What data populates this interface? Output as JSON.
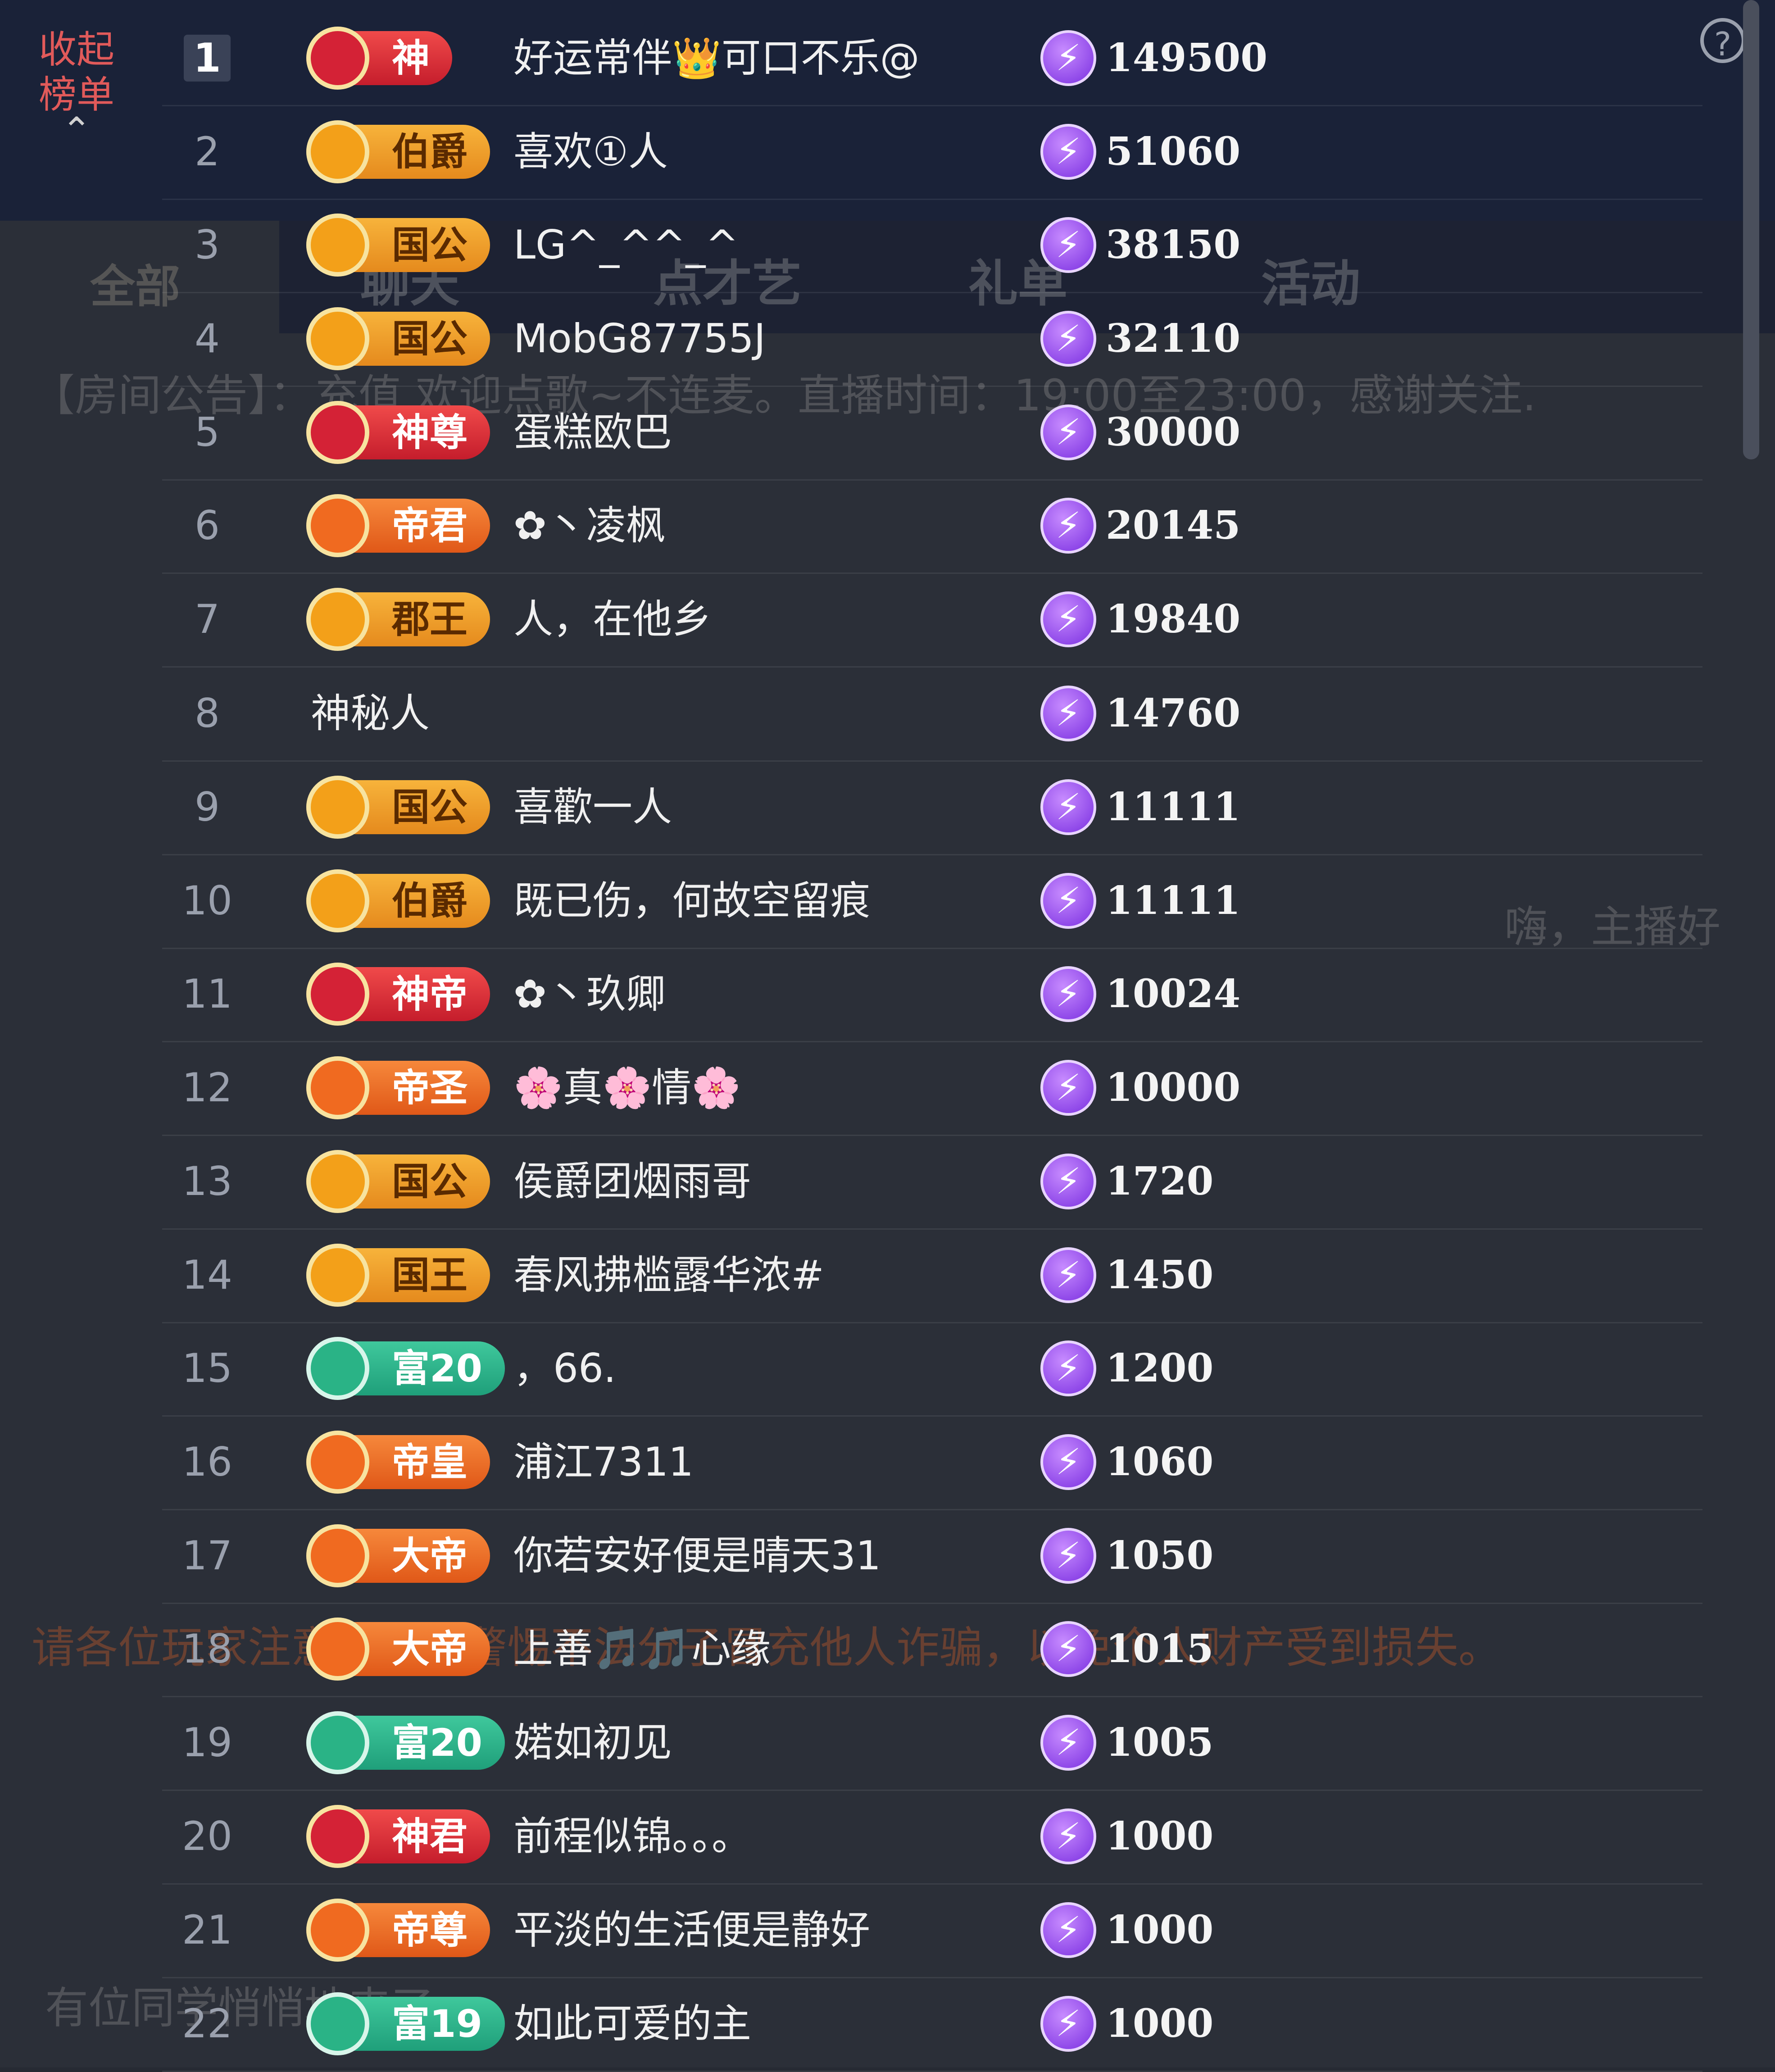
{
  "panel": {
    "collapse_label": "收起榜单",
    "collapse_icon": "chevron-up-icon",
    "help_icon": "question-circle-icon",
    "help_glyph": "?"
  },
  "background": {
    "tab_all": "全部",
    "tabs": [
      "聊天",
      "点才艺",
      "礼单",
      "活动"
    ],
    "announcement": "【房间公告】：",
    "announcement_text": "充值 欢迎点歌~不连麦。直播时间：19:00至23:00，感谢关注.",
    "warning": "请各位玩家注意防范，警惕不法分子冒充他人诈骗，以免个人财产受到损失。",
    "chat_hint": "有位同学悄悄地来了",
    "greeting": "嗨，主播好"
  },
  "ranking": [
    {
      "rank": "1",
      "badge": "神",
      "style": "red",
      "name": "好运常伴👑可口不乐@",
      "score": "149500"
    },
    {
      "rank": "2",
      "badge": "伯爵",
      "style": "gold",
      "name": "喜欢①人",
      "score": "51060"
    },
    {
      "rank": "3",
      "badge": "国公",
      "style": "gold",
      "name": "LG^_^^_^",
      "score": "38150"
    },
    {
      "rank": "4",
      "badge": "国公",
      "style": "gold",
      "name": "MobG87755J",
      "score": "32110"
    },
    {
      "rank": "5",
      "badge": "神尊",
      "style": "red",
      "name": "蛋糕欧巴",
      "score": "30000"
    },
    {
      "rank": "6",
      "badge": "帝君",
      "style": "orange",
      "name": "✿丶凌枫",
      "score": "20145"
    },
    {
      "rank": "7",
      "badge": "郡王",
      "style": "gold",
      "name": "人，在他乡",
      "score": "19840"
    },
    {
      "rank": "8",
      "badge": "",
      "style": "none",
      "name": "神秘人",
      "score": "14760"
    },
    {
      "rank": "9",
      "badge": "国公",
      "style": "gold",
      "name": "喜歡一人",
      "score": "11111"
    },
    {
      "rank": "10",
      "badge": "伯爵",
      "style": "gold",
      "name": "既已伤，何故空留痕",
      "score": "11111"
    },
    {
      "rank": "11",
      "badge": "神帝",
      "style": "red",
      "name": "✿丶玖卿",
      "score": "10024"
    },
    {
      "rank": "12",
      "badge": "帝圣",
      "style": "orange",
      "name": "🌸真🌸情🌸",
      "score": "10000"
    },
    {
      "rank": "13",
      "badge": "国公",
      "style": "gold",
      "name": "侯爵团烟雨哥",
      "score": "1720"
    },
    {
      "rank": "14",
      "badge": "国王",
      "style": "gold",
      "name": "春风拂槛露华浓#",
      "score": "1450"
    },
    {
      "rank": "15",
      "badge": "富20",
      "style": "teal",
      "name": "，66.",
      "score": "1200"
    },
    {
      "rank": "16",
      "badge": "帝皇",
      "style": "orange",
      "name": "浦江7311",
      "score": "1060"
    },
    {
      "rank": "17",
      "badge": "大帝",
      "style": "orange",
      "name": "你若安好便是晴天31",
      "score": "1050"
    },
    {
      "rank": "18",
      "badge": "大帝",
      "style": "orange",
      "name": "上善🎵🎵心缘",
      "score": "1015"
    },
    {
      "rank": "19",
      "badge": "富20",
      "style": "teal",
      "name": "婼如初见",
      "score": "1005"
    },
    {
      "rank": "20",
      "badge": "神君",
      "style": "red",
      "name": "前程似锦。。。",
      "score": "1000"
    },
    {
      "rank": "21",
      "badge": "帝尊",
      "style": "orange",
      "name": "平淡的生活便是静好",
      "score": "1000"
    },
    {
      "rank": "22",
      "badge": "富19",
      "style": "teal",
      "name": "如此可爱的主",
      "score": "1000"
    }
  ],
  "score_icon": "lightning-coin-icon",
  "score_glyph": "⚡"
}
